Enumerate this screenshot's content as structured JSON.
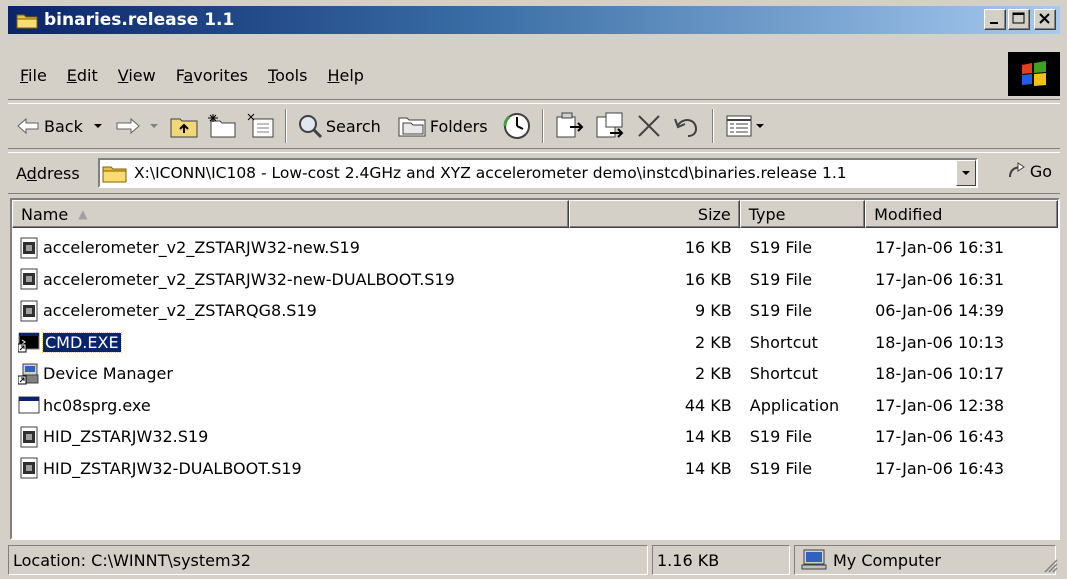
{
  "window": {
    "title": "binaries.release 1.1"
  },
  "menu": [
    {
      "key": "F",
      "rest": "ile"
    },
    {
      "key": "E",
      "rest": "dit"
    },
    {
      "key": "V",
      "rest": "iew"
    },
    {
      "pre": "F",
      "key": "a",
      "rest": "vorites"
    },
    {
      "key": "T",
      "rest": "ools"
    },
    {
      "key": "H",
      "rest": "elp"
    }
  ],
  "toolbar": {
    "back": "Back",
    "search": "Search",
    "folders": "Folders"
  },
  "address": {
    "label_pre": "A",
    "label_key": "d",
    "label_rest": "dress",
    "path": "X:\\ICONN\\IC108 - Low-cost 2.4GHz and XYZ accelerometer demo\\instcd\\binaries.release 1.1",
    "go": "Go"
  },
  "columns": {
    "name": "Name",
    "size": "Size",
    "type": "Type",
    "modified": "Modified"
  },
  "files": [
    {
      "name": "accelerometer_v2_ZSTARJW32-new.S19",
      "size": "16 KB",
      "type": "S19 File",
      "modified": "17-Jan-06 16:31",
      "icon": "s19-file-icon"
    },
    {
      "name": "accelerometer_v2_ZSTARJW32-new-DUALBOOT.S19",
      "size": "16 KB",
      "type": "S19 File",
      "modified": "17-Jan-06 16:31",
      "icon": "s19-file-icon"
    },
    {
      "name": "accelerometer_v2_ZSTARQG8.S19",
      "size": "9 KB",
      "type": "S19 File",
      "modified": "06-Jan-06 14:39",
      "icon": "s19-file-icon"
    },
    {
      "name": "CMD.EXE",
      "size": "2 KB",
      "type": "Shortcut",
      "modified": "18-Jan-06 10:13",
      "icon": "cmd-shortcut-icon"
    },
    {
      "name": "Device Manager",
      "size": "2 KB",
      "type": "Shortcut",
      "modified": "18-Jan-06 10:17",
      "icon": "device-manager-icon"
    },
    {
      "name": "hc08sprg.exe",
      "size": "44 KB",
      "type": "Application",
      "modified": "17-Jan-06 12:38",
      "icon": "application-icon"
    },
    {
      "name": "HID_ZSTARJW32.S19",
      "size": "14 KB",
      "type": "S19 File",
      "modified": "17-Jan-06 16:43",
      "icon": "s19-file-icon"
    },
    {
      "name": "HID_ZSTARJW32-DUALBOOT.S19",
      "size": "14 KB",
      "type": "S19 File",
      "modified": "17-Jan-06 16:43",
      "icon": "s19-file-icon"
    }
  ],
  "status": {
    "location": "Location: C:\\WINNT\\system32",
    "size": "1.16 KB",
    "zone": "My Computer"
  },
  "colors": {
    "title_start": "#0a246a",
    "title_end": "#a6caf0",
    "selection": "#0a246a",
    "chrome": "#d4d0c8"
  }
}
